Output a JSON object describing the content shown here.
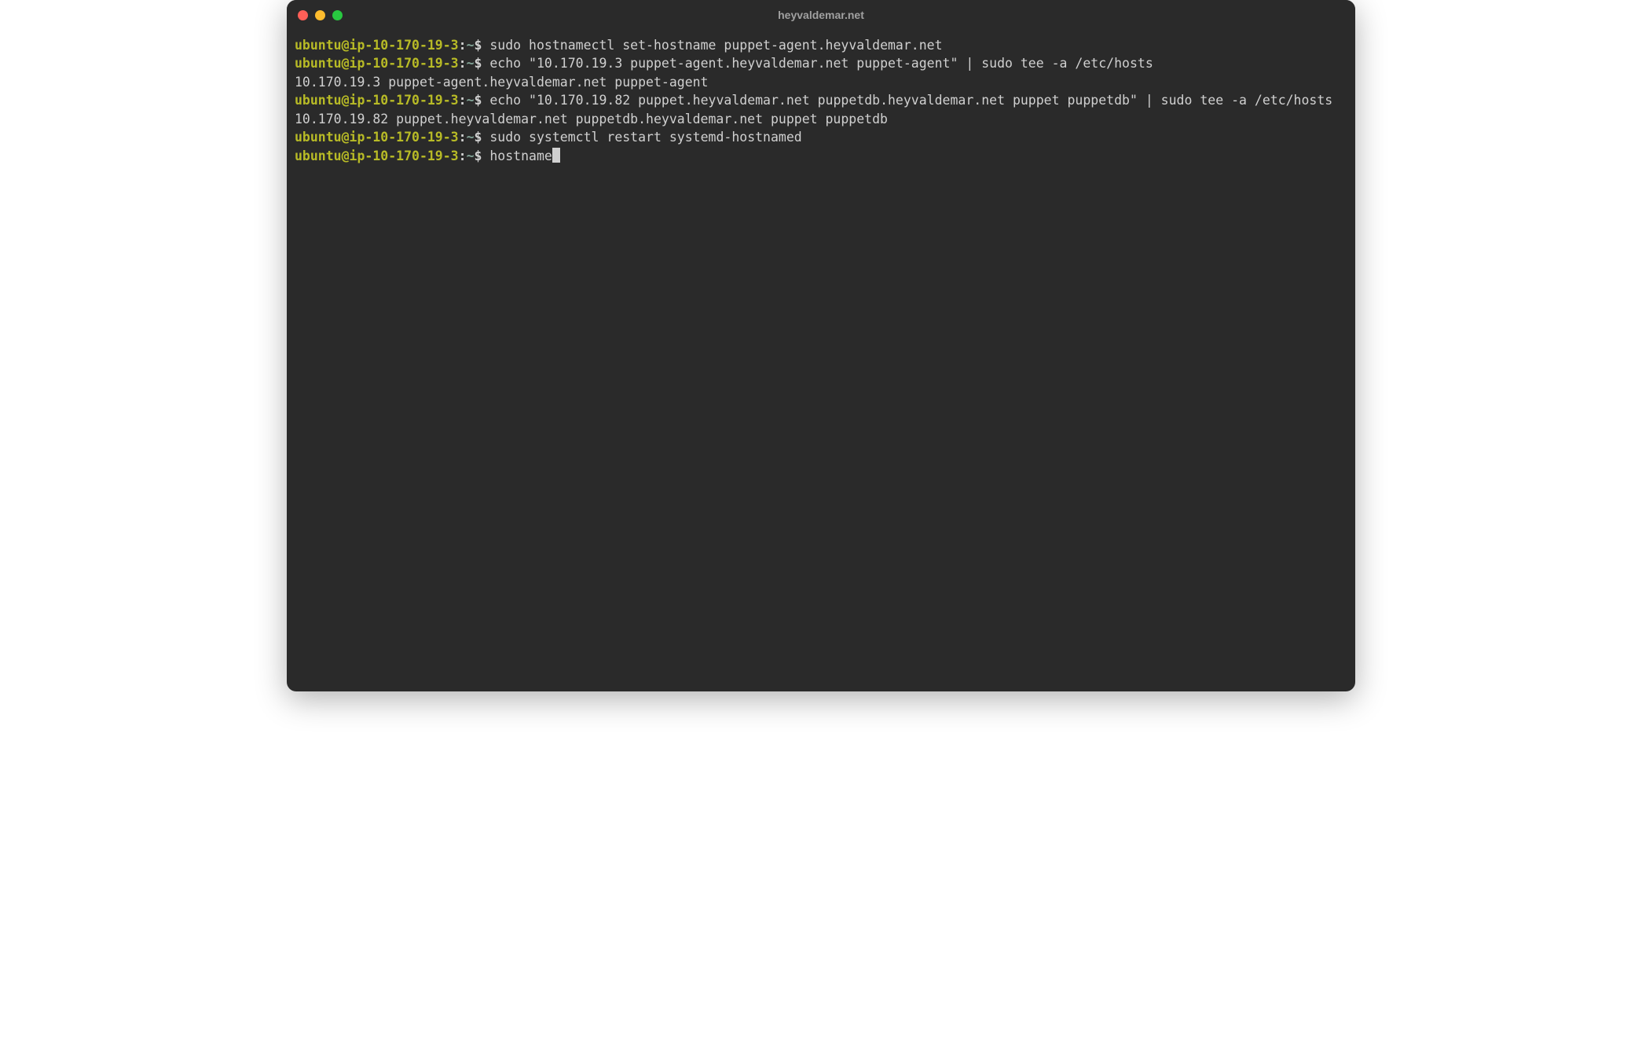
{
  "window": {
    "title": "heyvaldemar.net"
  },
  "prompt": {
    "user_host": "ubuntu@ip-10-170-19-3",
    "sep": ":",
    "path": "~",
    "symbol": "$"
  },
  "lines": [
    {
      "type": "cmd",
      "text": "sudo hostnamectl set-hostname puppet-agent.heyvaldemar.net"
    },
    {
      "type": "cmd",
      "text": "echo \"10.170.19.3 puppet-agent.heyvaldemar.net puppet-agent\" | sudo tee -a /etc/hosts"
    },
    {
      "type": "out",
      "text": "10.170.19.3 puppet-agent.heyvaldemar.net puppet-agent"
    },
    {
      "type": "cmd",
      "text": "echo \"10.170.19.82 puppet.heyvaldemar.net puppetdb.heyvaldemar.net puppet puppetdb\" | sudo tee -a /etc/hosts"
    },
    {
      "type": "out",
      "text": "10.170.19.82 puppet.heyvaldemar.net puppetdb.heyvaldemar.net puppet puppetdb"
    },
    {
      "type": "cmd",
      "text": "sudo systemctl restart systemd-hostnamed"
    },
    {
      "type": "cmd_cursor",
      "text": "hostname"
    }
  ]
}
